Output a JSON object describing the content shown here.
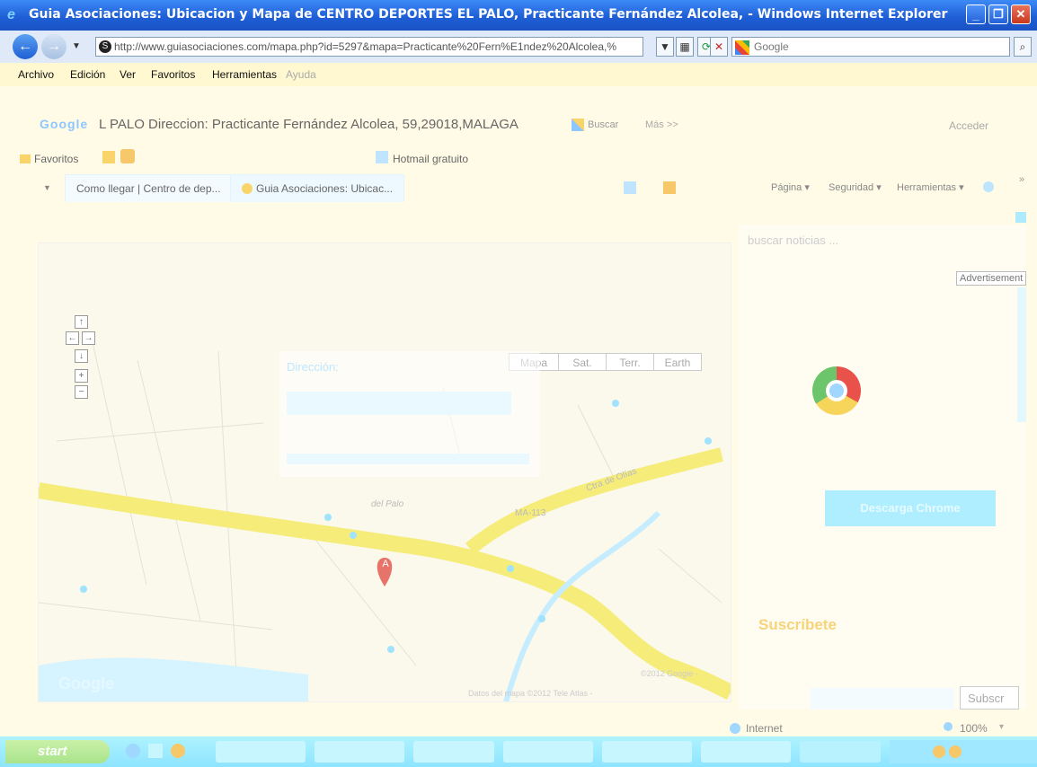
{
  "window": {
    "title": "Guia Asociaciones: Ubicacion y Mapa de CENTRO DEPORTES EL PALO, Practicante Fernández Alcolea,  - Windows Internet Explorer"
  },
  "address_bar": {
    "url": "http://www.guiasociaciones.com/mapa.php?id=5297&mapa=Practicante%20Fern%E1ndez%20Alcolea,%",
    "search_engine": "Google"
  },
  "menu": [
    "Archivo",
    "Edición",
    "Ver",
    "Favoritos",
    "Herramientas",
    "Ayuda"
  ],
  "google_toolbar": {
    "query": "L PALO Direccion: Practicante Fernández Alcolea, 59,29018,MALAGA",
    "search_label": "Buscar",
    "more_label": "Más >>",
    "signin_label": "Acceder"
  },
  "favorites_bar": {
    "favorites_label": "Favoritos",
    "hotmail_label": "Hotmail gratuito"
  },
  "tabs": [
    {
      "label": "Como llegar | Centro de dep..."
    },
    {
      "label": "Guia Asociaciones: Ubicac..."
    }
  ],
  "command_bar": {
    "page_label": "Página",
    "security_label": "Seguridad",
    "tools_label": "Herramientas"
  },
  "map": {
    "types": [
      "Mapa",
      "Sat.",
      "Terr.",
      "Earth"
    ],
    "marker_label": "A",
    "infowindow_title": "Dirección:",
    "street_labels": [
      "del Palo",
      "MA-113",
      "Ctra de Olías"
    ],
    "copyright": "©2012 Google -",
    "attribution": "Datos del mapa ©2012 Tele Atlas -",
    "logo": "Google"
  },
  "right_panel": {
    "search_placeholder": "buscar noticias ...",
    "ad_label": "Advertisement",
    "ad_button": "Descarga Chrome",
    "subscribe_title": "Suscríbete",
    "subscribe_button": "Subscr"
  },
  "status_bar": {
    "zone": "Internet",
    "zoom": "100%"
  },
  "colors": {
    "titlebar": "#1f5fd6",
    "road": "#f5ec7a",
    "marker": "#e6746a",
    "taskbar": "#9ee9ff"
  }
}
